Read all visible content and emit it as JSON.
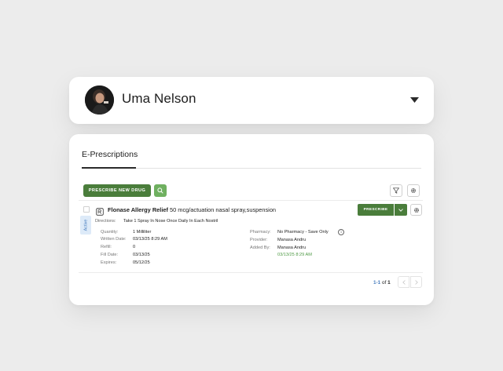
{
  "patient": {
    "name": "Uma Nelson",
    "avatar_icon": "avatar-photo",
    "expand_icon": "caret-down-icon"
  },
  "tabs": [
    {
      "label": "E-Prescriptions",
      "active": true
    }
  ],
  "toolbar": {
    "prescribe_new_label": "PRESCRIBE NEW DRUG",
    "search_icon": "search-icon",
    "filter_icon": "filter-icon",
    "settings_icon": "gear-icon"
  },
  "prescription": {
    "status": "Active",
    "drug_name": "Flonase Allergy Relief",
    "drug_detail": "50 mcg/actuation nasal spray,suspension",
    "prescribe_label": "PRESCRIBE",
    "directions_label": "Directions:",
    "directions": "Take 1 Spray In Nose Once Daily In Each Nostril",
    "left_fields": [
      {
        "label": "Quantity:",
        "value": "1 Milliliter"
      },
      {
        "label": "Written Date:",
        "value": "03/13/25 8:29 AM"
      },
      {
        "label": "Refill:",
        "value": "0"
      },
      {
        "label": "Fill Date:",
        "value": "03/13/25"
      },
      {
        "label": "Expires:",
        "value": "05/12/25"
      }
    ],
    "pharmacy_label": "Pharmacy:",
    "pharmacy": "No Pharmacy - Save Only",
    "provider_label": "Provider:",
    "provider": "Manasa Andru",
    "added_by_label": "Added By:",
    "added_by": "Manasa Andru",
    "added_timestamp": "03/13/25 8:29 AM"
  },
  "pagination": {
    "range": "1-1",
    "of_label": "of",
    "total": "1"
  },
  "colors": {
    "primary_green": "#4a7d3b",
    "light_green": "#6fb060",
    "timestamp_green": "#4f9a45",
    "active_badge_bg": "#ddeaf8",
    "link_blue": "#4a7fbf"
  }
}
